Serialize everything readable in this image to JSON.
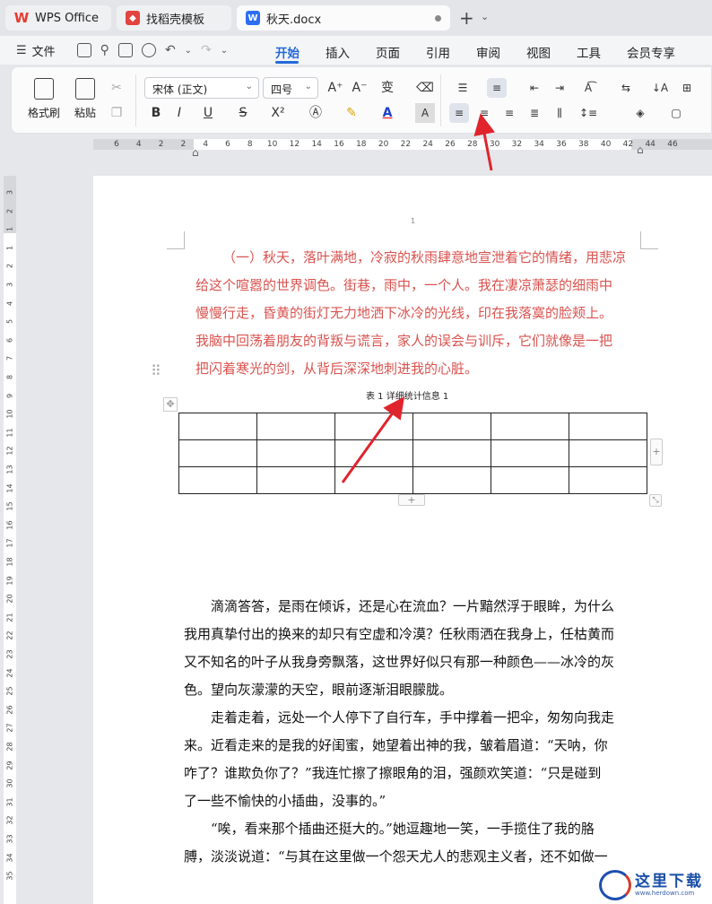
{
  "tabs": [
    {
      "label": "WPS Office",
      "icon": "wps-logo-icon"
    },
    {
      "label": "找稻壳模板",
      "icon": "docer-logo-icon"
    },
    {
      "label": "秋天.docx",
      "icon": "word-doc-icon",
      "logo_letter": "W"
    }
  ],
  "menu": {
    "file": "文件",
    "items": [
      "开始",
      "插入",
      "页面",
      "引用",
      "审阅",
      "视图",
      "工具",
      "会员专享"
    ],
    "active": "开始"
  },
  "ribbon": {
    "format_painter": "格式刷",
    "paste": "粘贴",
    "font_name": "宋体 (正文)",
    "font_size": "四号",
    "bold": "B",
    "italic": "I",
    "underline": "U",
    "strike": "S",
    "superscript": "X²",
    "char_shade": "A"
  },
  "ruler": {
    "h_labels": [
      "6",
      "4",
      "2",
      "2",
      "4",
      "6",
      "8",
      "10",
      "12",
      "14",
      "16",
      "18",
      "20",
      "22",
      "24",
      "26",
      "28",
      "30",
      "32",
      "34",
      "36",
      "38",
      "40",
      "42",
      "44",
      "46"
    ],
    "v_labels": [
      "3",
      "2",
      "1",
      "1",
      "2",
      "3",
      "4",
      "5",
      "6",
      "7",
      "8",
      "9",
      "10",
      "11",
      "12",
      "13",
      "14",
      "15",
      "16",
      "17",
      "18",
      "19",
      "20",
      "21",
      "22",
      "23",
      "24",
      "25",
      "26",
      "27",
      "28",
      "29",
      "30",
      "31",
      "32",
      "33",
      "34",
      "35"
    ]
  },
  "document": {
    "page_number": "1",
    "red_paragraph": [
      "（一）秋天，落叶满地，冷寂的秋雨肆意地宣泄着它的情绪，用悲凉",
      "给这个喧嚣的世界调色。街巷，雨中，一个人。我在凄凉萧瑟的细雨中",
      "慢慢行走，昏黄的街灯无力地洒下冰冷的光线，印在我落寞的脸颊上。",
      "我脑中回荡着朋友的背叛与谎言，家人的误会与训斥，它们就像是一把",
      "把闪着寒光的剑，从背后深深地刺进我的心脏。"
    ],
    "table_caption": "表 1 详细统计信息 1",
    "table": {
      "rows": 3,
      "cols": 6
    },
    "body_paragraphs": [
      [
        "　　滴滴答答，是雨在倾诉，还是心在流血？一片黯然浮于眼眸，为什么",
        "我用真挚付出的换来的却只有空虚和冷漠？任秋雨洒在我身上，任枯黄而",
        "又不知名的叶子从我身旁飘落，这世界好似只有那一种颜色——冰冷的灰",
        "色。望向灰濛濛的天空，眼前逐渐泪眼朦胧。"
      ],
      [
        "　　走着走着，远处一个人停下了自行车，手中撑着一把伞，匆匆向我走",
        "来。近看走来的是我的好闺蜜，她望着出神的我，皱着眉道：“天呐，你",
        "咋了？谁欺负你了？”我连忙擦了擦眼角的泪，强颜欢笑道：“只是碰到",
        "了一些不愉快的小插曲，没事的。”"
      ],
      [
        "　　“唉，看来那个插曲还挺大的。”她逗趣地一笑，一手揽住了我的胳",
        "膊，淡淡说道：“与其在这里做一个怨天尤人的悲观主义者，还不如做一"
      ]
    ]
  },
  "watermark": {
    "text": "这里下载",
    "url": "www.herdown.com"
  },
  "colors": {
    "accent": "#2469d8",
    "red_text": "#d9534f",
    "arrow": "#e0242c"
  }
}
